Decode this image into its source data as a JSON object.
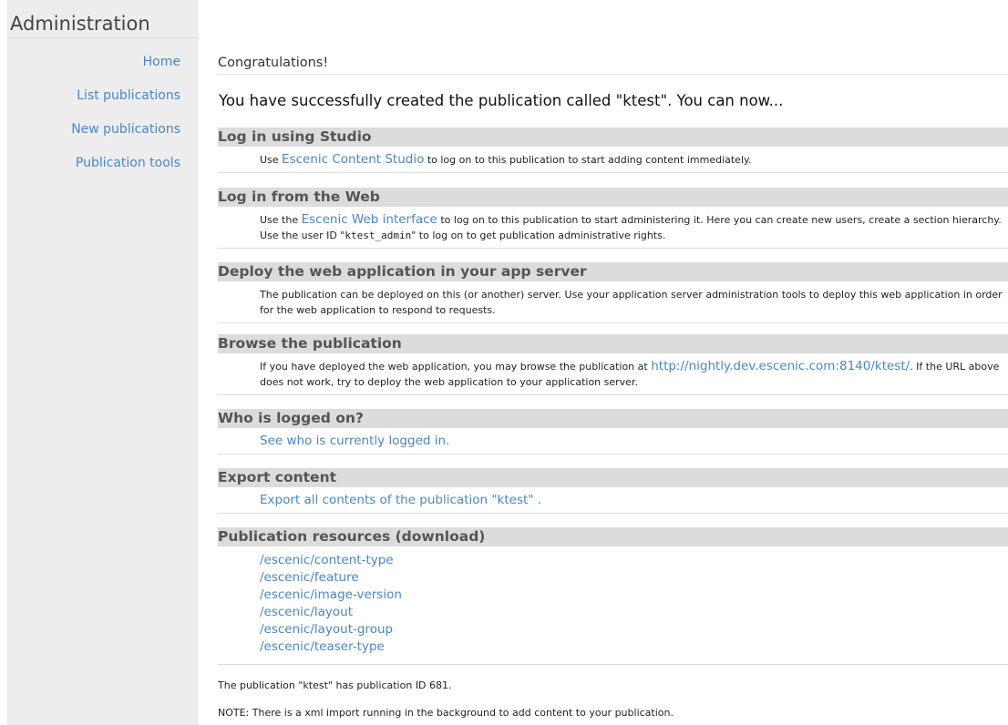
{
  "sidebar": {
    "title": "Administration",
    "items": [
      {
        "label": "Home"
      },
      {
        "label": "List publications"
      },
      {
        "label": "New publications"
      },
      {
        "label": "Publication tools"
      }
    ]
  },
  "main": {
    "congrats": "Congratulations!",
    "lead": "You have successfully created the publication called \"ktest\". You can now...",
    "studio": {
      "heading": "Log in using Studio",
      "pre": "Use ",
      "link": "Escenic Content Studio",
      "post": " to log on to this publication to start adding content immediately."
    },
    "web": {
      "heading": "Log in from the Web",
      "pre": "Use the ",
      "link": "Escenic Web interface",
      "post": " to log on to this publication to start administering it. Here you can create new users, create a section hierarchy. Use the user ID \"",
      "user_id": "ktest_admin",
      "post2": "\" to log on to get publication administrative rights."
    },
    "deploy": {
      "heading": "Deploy the web application in your app server",
      "text": "The publication can be deployed on this (or another) server. Use your application server administration tools to deploy this web application in order for the web application to respond to requests."
    },
    "browse": {
      "heading": "Browse the publication",
      "pre": "If you have deployed the web application, you may browse the publication at ",
      "link": "http://nightly.dev.escenic.com:8140/ktest/",
      "post": ". If the URL above does not work, try to deploy the web application to your application server."
    },
    "logged": {
      "heading": "Who is logged on?",
      "link": "See who is currently logged in."
    },
    "export": {
      "heading": "Export content",
      "link": "Export all contents of the publication \"ktest\" ."
    },
    "resources": {
      "heading": "Publication resources (download)",
      "items": [
        "/escenic/content-type",
        "/escenic/feature",
        "/escenic/image-version",
        "/escenic/layout",
        "/escenic/layout-group",
        "/escenic/teaser-type"
      ]
    },
    "pubid": "The publication \"ktest\" has publication ID 681.",
    "note": "NOTE: There is a xml import running in the background to add content to your publication."
  },
  "colors": {
    "link": "#4a86c8",
    "section_bar": "#dcdcdc",
    "sidebar_bg": "#ededed"
  }
}
